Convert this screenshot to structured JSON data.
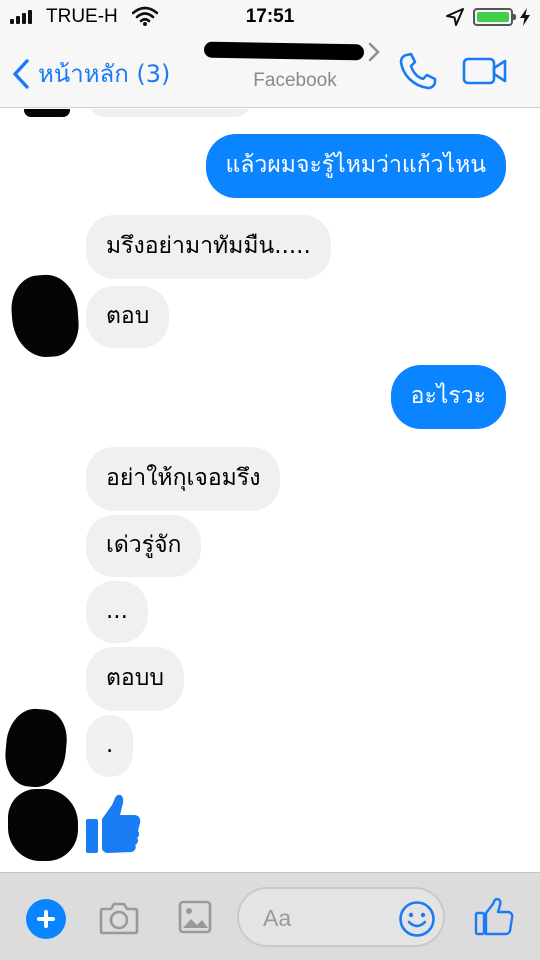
{
  "status_bar": {
    "carrier": "TRUE-H",
    "time": "17:51",
    "icons": [
      "signal-icon",
      "wifi-icon",
      "location-arrow-icon",
      "battery-icon",
      "charging-bolt-icon"
    ],
    "battery_color": "#3fcf4a"
  },
  "nav": {
    "back_label": "หน้าหลัก (3)",
    "subtitle": "Facebook",
    "accent_color": "#1a7cf4"
  },
  "messages": [
    {
      "id": "m1",
      "side": "out",
      "text": "แล้วผมจะรู้ไหมว่าแก้วไหน"
    },
    {
      "id": "m2",
      "side": "in",
      "text": "มรึงอย่ามาทัมมืน....."
    },
    {
      "id": "m3",
      "side": "in",
      "text": "ตอบ"
    },
    {
      "id": "m4",
      "side": "out",
      "text": "อะไรวะ"
    },
    {
      "id": "m5",
      "side": "in",
      "text": "อย่าให้กุเจอมรึง"
    },
    {
      "id": "m6",
      "side": "in",
      "text": "เด่วรู่จัก"
    },
    {
      "id": "m7",
      "side": "in",
      "text": "..."
    },
    {
      "id": "m8",
      "side": "in",
      "text": "ตอบบ"
    },
    {
      "id": "m9",
      "side": "in",
      "text": "."
    }
  ],
  "colors": {
    "outgoing_bubble": "#0a84ff",
    "incoming_bubble": "#f0f0f0"
  },
  "composer": {
    "placeholder": "Aa",
    "icons": [
      "plus-icon",
      "camera-icon",
      "gallery-icon",
      "emoji-icon",
      "thumbs-up-icon"
    ]
  }
}
